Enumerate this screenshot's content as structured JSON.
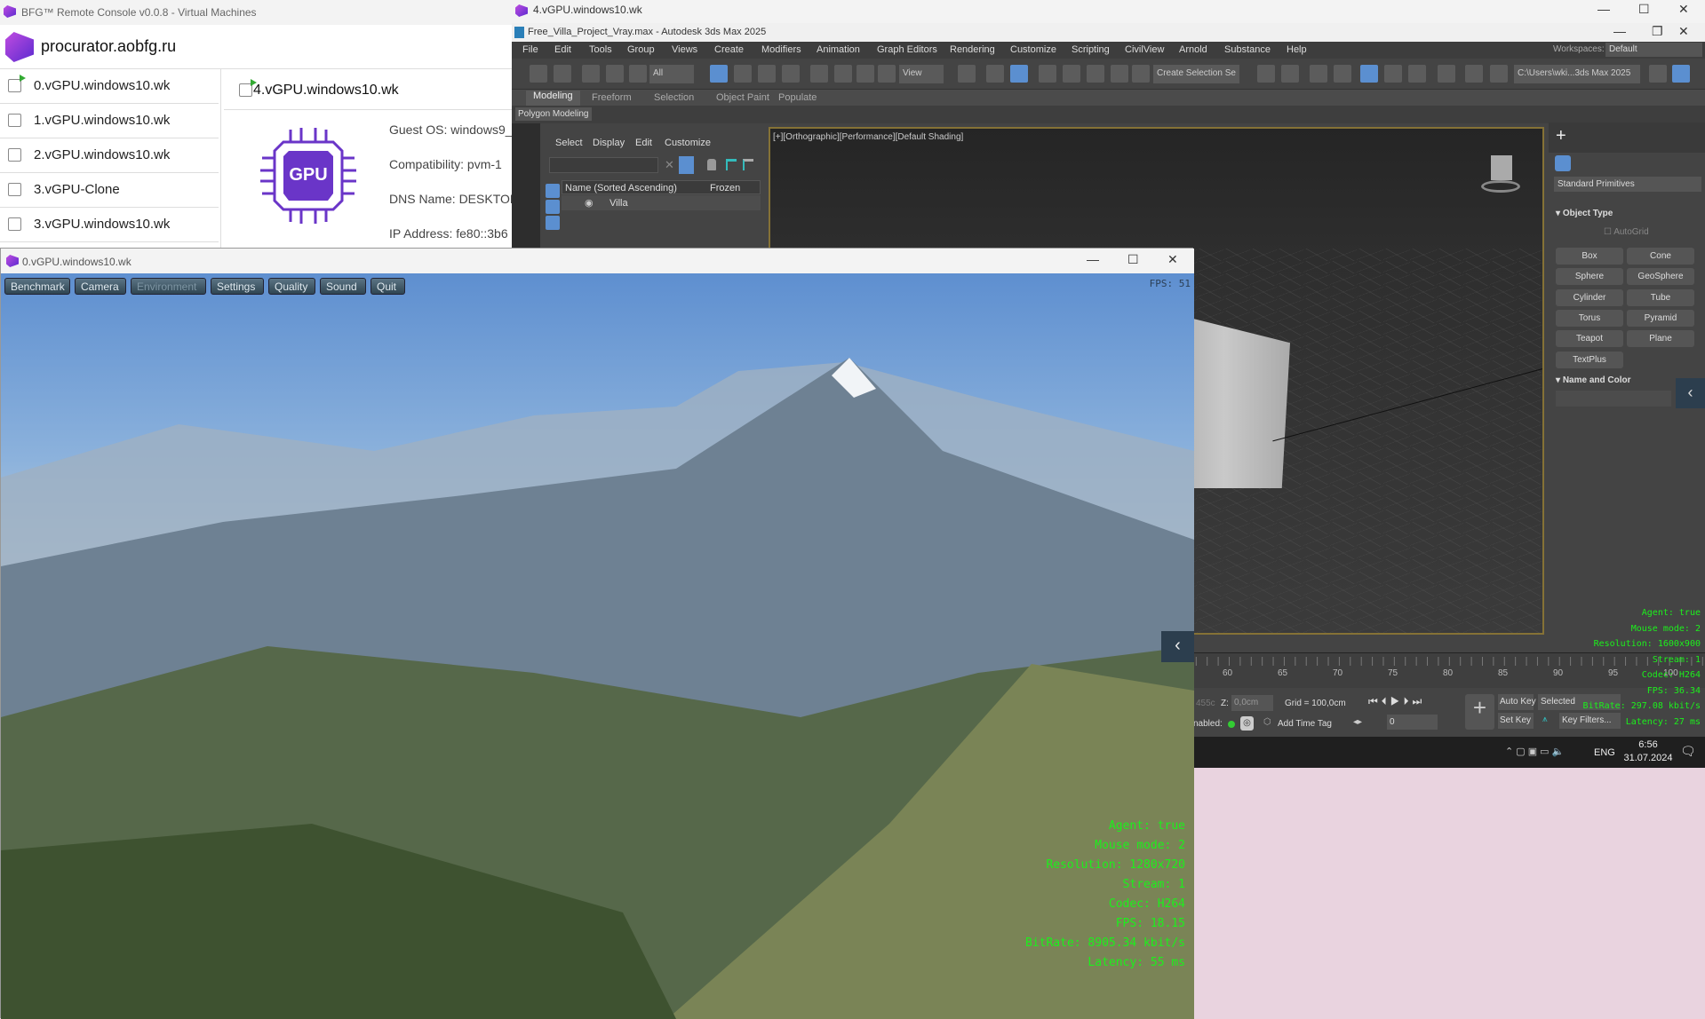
{
  "bfg": {
    "title": "BFG™ Remote Console v0.0.8 - Virtual Machines",
    "host": "procurator.aobfg.ru",
    "vms": [
      {
        "name": "0.vGPU.windows10.wk",
        "running": true
      },
      {
        "name": "1.vGPU.windows10.wk",
        "running": false
      },
      {
        "name": "2.vGPU.windows10.wk",
        "running": false
      },
      {
        "name": "3.vGPU-Clone",
        "running": false
      },
      {
        "name": "3.vGPU.windows10.wk",
        "running": false
      }
    ],
    "selected": {
      "name": "4.vGPU.windows10.wk",
      "gpu_label": "GPU",
      "guest_os": "Guest OS: windows9_",
      "compat": "Compatibility: pvm-1",
      "dns": "DNS Name: DESKTOP",
      "ip": "IP Address:  fe80::3b6"
    }
  },
  "max": {
    "outer_title": "4.vGPU.windows10.wk",
    "title": "Free_Villa_Project_Vray.max - Autodesk 3ds Max 2025",
    "menu": [
      "File",
      "Edit",
      "Tools",
      "Group",
      "Views",
      "Create",
      "Modifiers",
      "Animation",
      "Graph Editors",
      "Rendering",
      "Customize",
      "Scripting",
      "CivilView",
      "Arnold",
      "Substance",
      "Help"
    ],
    "workspaces_label": "Workspaces:",
    "workspace": "Default",
    "filter": "All",
    "view": "View",
    "selset": "Create Selection Se",
    "path": "C:\\Users\\wki...3ds Max 2025",
    "ribbon_tabs": [
      "Modeling",
      "Freeform",
      "Selection",
      "Object Paint",
      "Populate"
    ],
    "ribbon_panel": "Polygon Modeling",
    "explorer": {
      "menu": [
        "Select",
        "Display",
        "Edit",
        "Customize"
      ],
      "col_name": "Name (Sorted Ascending)",
      "col_frozen": "Frozen",
      "item": "Villa"
    },
    "viewport_label": "[+][Orthographic][Performance][Default Shading]",
    "cmd": {
      "category": "Standard Primitives",
      "rollout1": "Object Type",
      "autogrid": "AutoGrid",
      "buttons": [
        "Box",
        "Cone",
        "Sphere",
        "GeoSphere",
        "Cylinder",
        "Tube",
        "Torus",
        "Pyramid",
        "Teapot",
        "Plane",
        "TextPlus"
      ],
      "rollout2": "Name and Color"
    },
    "timeline_ticks": [
      "60",
      "65",
      "70",
      "75",
      "80",
      "85",
      "90",
      "95",
      "100"
    ],
    "status": {
      "z_label": "Z:",
      "z_value": "0,0cm",
      "x_partial": "455c",
      "grid": "Grid = 100,0cm",
      "enabled": "nabled:",
      "add_time_tag": "Add Time Tag",
      "frame": "0",
      "auto_key": "Auto Key",
      "set_key": "Set Key",
      "selected": "Selected",
      "key_filters": "Key Filters..."
    },
    "taskbar": {
      "lang": "ENG",
      "time": "6:56",
      "date": "31.07.2024"
    },
    "stats": [
      "Agent: true",
      "Mouse mode: 2",
      "Resolution: 1600x900",
      "Stream:  1",
      "Codec: H264",
      "FPS: 36.34",
      "BitRate: 297.08 kbit/s",
      "Latency: 27 ms"
    ]
  },
  "game": {
    "title": "0.vGPU.windows10.wk",
    "menu": [
      "Benchmark",
      "Camera",
      "Environment",
      "Settings",
      "Quality",
      "Sound",
      "Quit"
    ],
    "fps": "FPS: 51",
    "stats": [
      "Agent: true",
      "Mouse mode: 2",
      "Resolution: 1280x720",
      "Stream:  1",
      "Codec: H264",
      "FPS: 18.15",
      "BitRate: 8905.34 kbit/s",
      "Latency: 55 ms"
    ]
  },
  "colors": {
    "accent": "#5b8fd0",
    "stats_green": "#1cf01c",
    "viewport_border": "#857236",
    "brand": "#6a35c8"
  }
}
